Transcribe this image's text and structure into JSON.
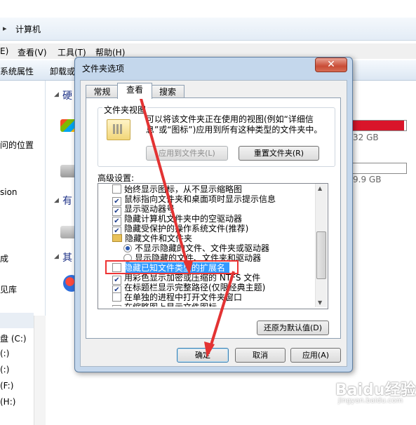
{
  "explorer": {
    "address": "计算机",
    "menu": [
      "E)",
      "查看(V)",
      "工具(T)",
      "帮助(H)"
    ],
    "commands": [
      "系统属性",
      "卸载或"
    ],
    "nav_items": [
      "问的位置",
      "sion",
      "成",
      "见库",
      "盘 (C:)",
      "(:)",
      "(:)",
      "(F:)",
      "(H:)"
    ],
    "sections": [
      "硬",
      "有",
      "其"
    ],
    "drives": [
      {
        "capacity_text": "32 GB",
        "fill_color": "#d9152a",
        "fill_pct": 96
      },
      {
        "capacity_text": "9.9 GB",
        "fill_color": "#26a0da",
        "fill_pct": 3
      }
    ]
  },
  "dialog": {
    "title": "文件夹选项",
    "close_label": "✕",
    "tabs": [
      "常规",
      "查看",
      "搜索"
    ],
    "folder_views": {
      "label": "文件夹视图",
      "description": "可以将该文件夹正在使用的视图(例如“详细信息”或“图标”)应用到所有这种类型的文件夹中。",
      "apply_button": "应用到文件夹(L)",
      "reset_button": "重置文件夹(R)"
    },
    "advanced_label": "高级设置:",
    "settings": [
      {
        "type": "checkbox",
        "checked": false,
        "indent": 0,
        "label": "始终显示图标，从不显示缩略图"
      },
      {
        "type": "checkbox",
        "checked": true,
        "indent": 0,
        "label": "鼠标指向文件夹和桌面项时显示提示信息"
      },
      {
        "type": "checkbox",
        "checked": true,
        "indent": 0,
        "label": "显示驱动器号"
      },
      {
        "type": "checkbox",
        "checked": true,
        "indent": 0,
        "label": "隐藏计算机文件夹中的空驱动器"
      },
      {
        "type": "checkbox",
        "checked": true,
        "indent": 0,
        "label": "隐藏受保护的操作系统文件(推荐)"
      },
      {
        "type": "folder",
        "checked": false,
        "indent": 0,
        "label": "隐藏文件和文件夹"
      },
      {
        "type": "radio",
        "checked": true,
        "indent": 1,
        "label": "不显示隐藏的文件、文件夹或驱动器"
      },
      {
        "type": "radio",
        "checked": false,
        "indent": 1,
        "label": "显示隐藏的文件、文件夹和驱动器"
      },
      {
        "type": "checkbox",
        "checked": false,
        "indent": 0,
        "label": "隐藏已知文件类型的扩展名",
        "selected": true
      },
      {
        "type": "checkbox",
        "checked": true,
        "indent": 0,
        "label": "用彩色显示加密或压缩的 NTFS 文件"
      },
      {
        "type": "checkbox",
        "checked": true,
        "indent": 0,
        "label": "在标题栏显示完整路径(仅限经典主题)"
      },
      {
        "type": "checkbox",
        "checked": false,
        "indent": 0,
        "label": "在单独的进程中打开文件夹窗口"
      },
      {
        "type": "checkbox",
        "checked": true,
        "indent": 0,
        "label": "在缩略图上显示文件图标"
      }
    ],
    "restore_button": "还原为默认值(D)",
    "ok_button": "确定",
    "cancel_button": "取消",
    "apply_button": "应用(A)"
  },
  "watermark": {
    "brand": "Baidu经验",
    "url": "jingyan.baidu.com"
  },
  "colors": {
    "annotation_red": "#e33333",
    "selection_blue": "#3399ff"
  }
}
